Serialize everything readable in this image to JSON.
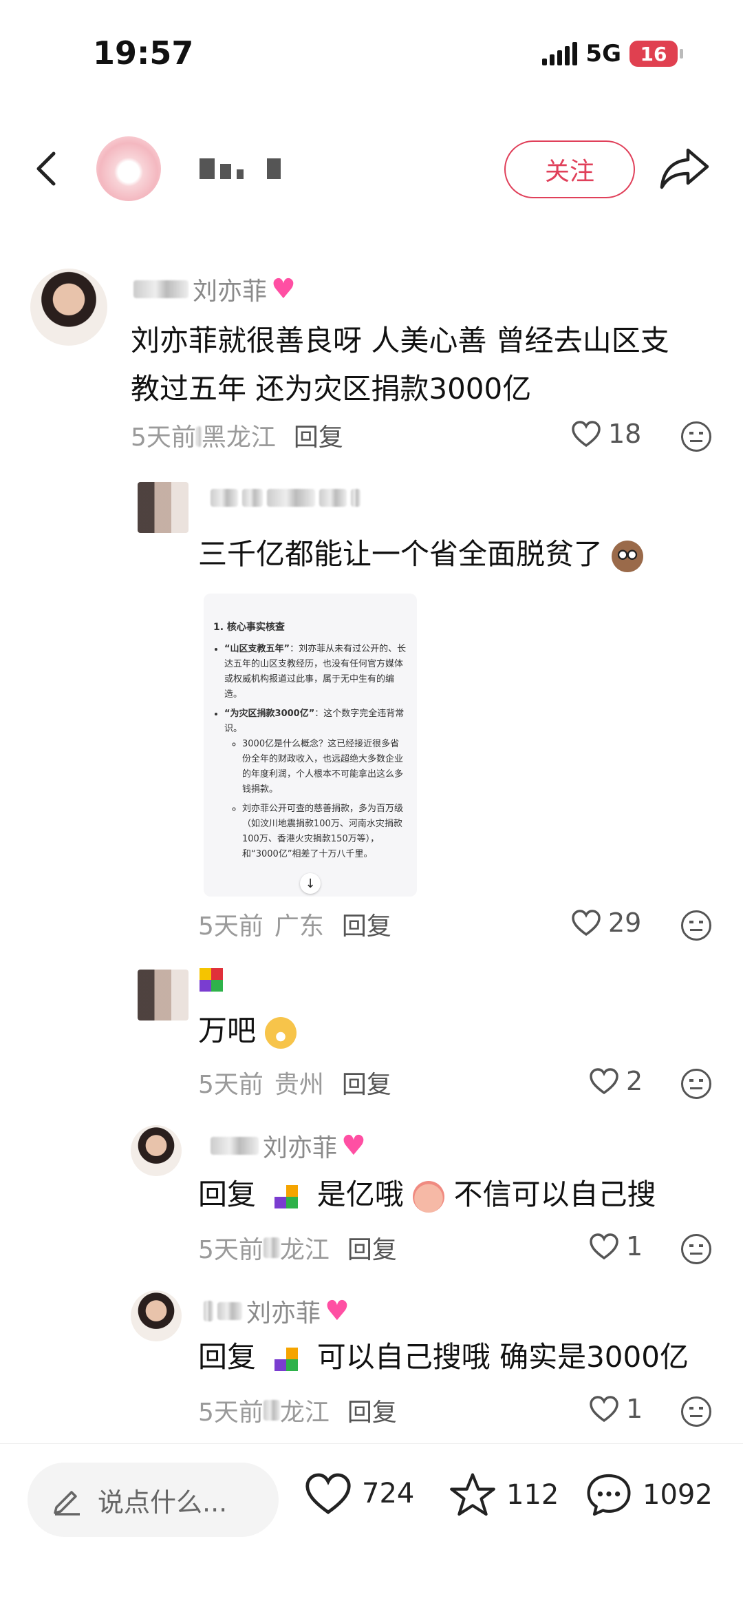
{
  "status": {
    "time": "19:57",
    "network": "5G",
    "battery": "16"
  },
  "header": {
    "follow_label": "关注"
  },
  "comments": [
    {
      "username_suffix": "刘亦菲",
      "text_lines": [
        "刘亦菲就很善良呀 人美心善 曾经去山区支",
        "教过五年 还为灾区捐款3000亿"
      ],
      "time": "5天前",
      "location": "黑龙江",
      "reply_label": "回复",
      "likes": "18"
    },
    {
      "text": "三千亿都能让一个省全面脱贫了",
      "time": "5天前",
      "location": "广东",
      "reply_label": "回复",
      "likes": "29",
      "embed": {
        "heading": "1. 核心事实核查",
        "b1_title": "“山区支教五年”",
        "b1_text": "：刘亦菲从未有过公开的、长达五年的山区支教经历，也没有任何官方媒体或权威机构报道过此事，属于无中生有的编造。",
        "b2_title": "“为灾区捐款3000亿”",
        "b2_text": "：这个数字完全违背常识。",
        "s1": "3000亿是什么概念？这已经接近很多省份全年的财政收入，也远超绝大多数企业的年度利润，个人根本不可能拿出这么多钱捐款。",
        "s2": "刘亦菲公开可查的慈善捐款，多为百万级（如汶川地震捐款100万、河南水灾捐款100万、香港火灾捐款150万等），和“3000亿”相差了十万八千里。"
      }
    },
    {
      "text": "万吧",
      "time": "5天前",
      "location": "贵州",
      "reply_label": "回复",
      "likes": "2"
    },
    {
      "username_suffix": "刘亦菲",
      "reply_prefix": "回复",
      "text": "是亿哦",
      "text2": "不信可以自己搜",
      "time": "5天前",
      "location": "龙江",
      "reply_label": "回复",
      "likes": "1"
    },
    {
      "username_suffix": "刘亦菲",
      "reply_prefix": "回复",
      "text": "可以自己搜哦 确实是3000亿",
      "time": "5天前",
      "location": "龙江",
      "reply_label": "回复",
      "likes": "1"
    }
  ],
  "bottom": {
    "input_placeholder": "说点什么...",
    "likes": "724",
    "stars": "112",
    "comments": "1092"
  },
  "colors": {
    "accent": "#e0405a",
    "text_muted": "#9a9a9a"
  },
  "icons": [
    "back-icon",
    "share-icon",
    "heart-icon",
    "star-icon",
    "comment-icon",
    "pencil-icon",
    "face-icon"
  ]
}
